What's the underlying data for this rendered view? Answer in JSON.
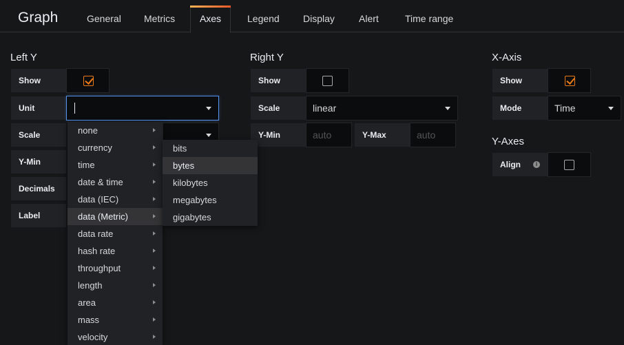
{
  "header": {
    "title": "Graph",
    "tabs": [
      "General",
      "Metrics",
      "Axes",
      "Legend",
      "Display",
      "Alert",
      "Time range"
    ],
    "active_tab": "Axes"
  },
  "left_y": {
    "title": "Left Y",
    "show_label": "Show",
    "show_checked": true,
    "unit_label": "Unit",
    "unit_value": "",
    "scale_label": "Scale",
    "ymin_label": "Y-Min",
    "decimals_label": "Decimals",
    "label_label": "Label"
  },
  "right_y": {
    "title": "Right Y",
    "show_label": "Show",
    "show_checked": false,
    "scale_label": "Scale",
    "scale_value": "linear",
    "ymin_label": "Y-Min",
    "ymin_placeholder": "auto",
    "ymax_label": "Y-Max",
    "ymax_placeholder": "auto"
  },
  "x_axis": {
    "title": "X-Axis",
    "show_label": "Show",
    "show_checked": true,
    "mode_label": "Mode",
    "mode_value": "Time"
  },
  "y_axes": {
    "title": "Y-Axes",
    "align_label": "Align",
    "align_checked": false
  },
  "unit_menu": {
    "items": [
      "none",
      "currency",
      "time",
      "date & time",
      "data (IEC)",
      "data (Metric)",
      "data rate",
      "hash rate",
      "throughput",
      "length",
      "area",
      "mass",
      "velocity"
    ],
    "active": "data (Metric)"
  },
  "unit_submenu": {
    "items": [
      "bits",
      "bytes",
      "kilobytes",
      "megabytes",
      "gigabytes"
    ],
    "active": "bytes"
  },
  "colors": {
    "accent": "#eb7b18",
    "focus": "#5794f2"
  }
}
